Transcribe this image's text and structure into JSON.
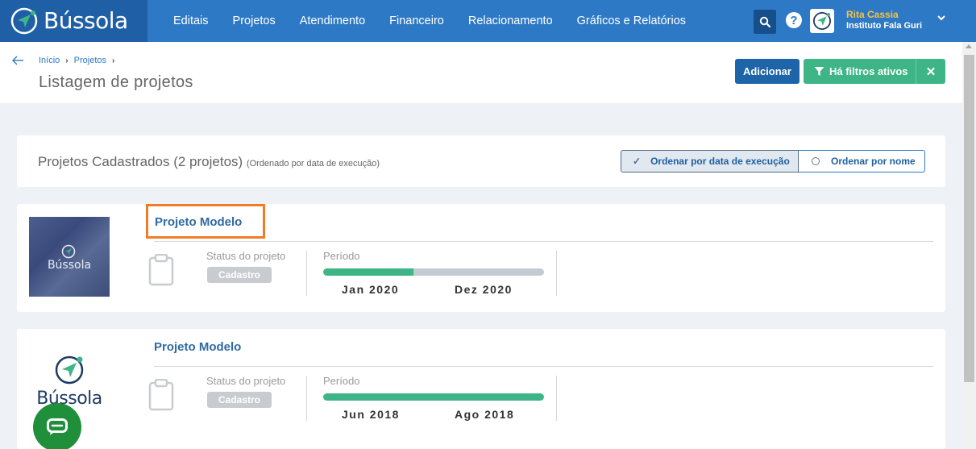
{
  "brand": {
    "name": "Bússola"
  },
  "nav": {
    "items": [
      "Editais",
      "Projetos",
      "Atendimento",
      "Financeiro",
      "Relacionamento",
      "Gráficos e Relatórios"
    ],
    "help_symbol": "?"
  },
  "user": {
    "name": "Rita Cassia",
    "org": "Instituto Fala Guri"
  },
  "breadcrumb": [
    "Início",
    "Projetos"
  ],
  "header": {
    "title": "Listagem de projetos",
    "add_label": "Adicionar",
    "filter_label": "Há filtros ativos",
    "filter_clear": "✕"
  },
  "list": {
    "title": "Projetos Cadastrados (2 projetos)",
    "subtitle": "(Ordenado por data de execução)",
    "sort_by_date": "Ordenar por data de execução",
    "sort_by_name": "Ordenar por nome",
    "sort_check": "✓"
  },
  "projects": [
    {
      "name": "Projeto Modelo",
      "thumb_text": "Bússola",
      "status_label": "Status do projeto",
      "status": "Cadastro",
      "period_label": "Período",
      "start": "Jan 2020",
      "end": "Dez 2020",
      "progress": 0.41
    },
    {
      "name": "Projeto Modelo",
      "thumb_text": "Bússola",
      "status_label": "Status do projeto",
      "status": "Cadastro",
      "period_label": "Período",
      "start": "Jun 2018",
      "end": "Ago 2018",
      "progress": 1.0
    }
  ],
  "colors": {
    "nav": "#2e79c6",
    "brand_bg": "#1f5fa6",
    "primary_button": "#1d64a8",
    "success": "#3db586",
    "highlight_border": "#f07c29",
    "chat": "#1f8f3a"
  },
  "icons": [
    "back-arrow-icon",
    "search-icon",
    "help-icon",
    "compass-logo-icon",
    "chevron-down-icon",
    "filter-icon",
    "close-icon",
    "check-icon",
    "radio-icon",
    "clipboard-icon",
    "chat-icon"
  ]
}
